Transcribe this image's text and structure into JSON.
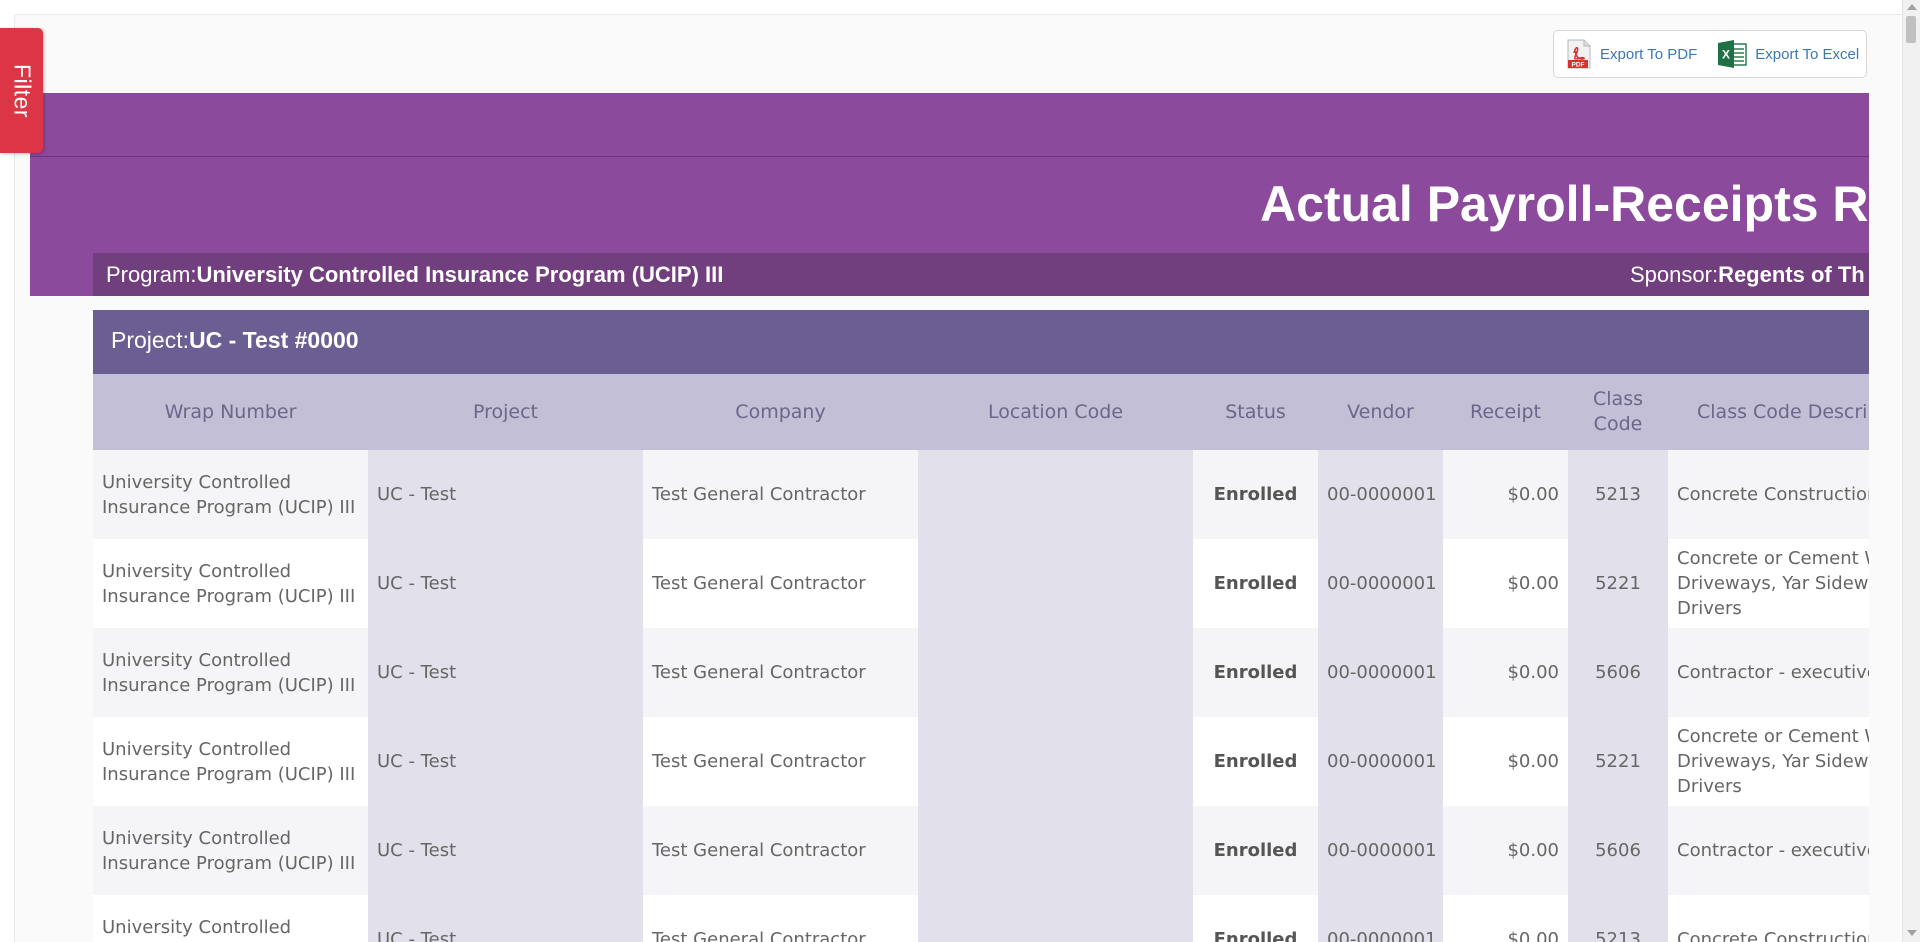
{
  "filter": {
    "label": "Filter"
  },
  "export": {
    "pdf_label": "Export To PDF",
    "excel_label": "Export To Excel"
  },
  "report": {
    "title": "Actual Payroll-Receipts Re",
    "program_label": "Program:",
    "program_value": "University Controlled Insurance Program (UCIP) III",
    "sponsor_label": "Sponsor:",
    "sponsor_value": "Regents of Th",
    "project_label": "Project:",
    "project_value": "UC - Test #0000"
  },
  "table": {
    "headers": [
      "Wrap Number",
      "Project",
      "Company",
      "Location Code",
      "Status",
      "Vendor",
      "Receipt",
      "Class Code",
      "Class Code Descrip"
    ],
    "rows": [
      [
        "University Controlled Insurance Program (UCIP) III",
        "UC - Test",
        "Test General Contractor",
        "",
        "Enrolled",
        "00-0000001",
        "$0.00",
        "5213",
        "Concrete Construction & Drivers"
      ],
      [
        "University Controlled Insurance Program (UCIP) III",
        "UC - Test",
        "Test General Contractor",
        "",
        "Enrolled",
        "00-0000001",
        "$0.00",
        "5221",
        "Concrete or Cement W Floors, Driveways, Yar Sidewalks - & Drivers"
      ],
      [
        "University Controlled Insurance Program (UCIP) III",
        "UC - Test",
        "Test General Contractor",
        "",
        "Enrolled",
        "00-0000001",
        "$0.00",
        "5606",
        "Contractor - executive supervisor"
      ],
      [
        "University Controlled Insurance Program (UCIP) III",
        "UC - Test",
        "Test General Contractor",
        "",
        "Enrolled",
        "00-0000001",
        "$0.00",
        "5221",
        "Concrete or Cement W Floors, Driveways, Yar Sidewalks - & Drivers"
      ],
      [
        "University Controlled Insurance Program (UCIP) III",
        "UC - Test",
        "Test General Contractor",
        "",
        "Enrolled",
        "00-0000001",
        "$0.00",
        "5606",
        "Contractor - executive supervisor"
      ],
      [
        "University Controlled Insurance Program (UCIP) III",
        "UC - Test",
        "Test General Contractor",
        "",
        "Enrolled",
        "00-0000001",
        "$0.00",
        "5213",
        "Concrete Construction & Drivers"
      ]
    ]
  },
  "colors": {
    "filter_tab": "#dc3545",
    "report_band": "#8c4a9c",
    "program_bar": "#723f7e",
    "project_bar": "#6a5e92",
    "table_header": "#c2bfd6",
    "export_link": "#3a78b8"
  },
  "icons": {
    "pdf": "pdf-file-icon",
    "excel": "excel-file-icon"
  }
}
